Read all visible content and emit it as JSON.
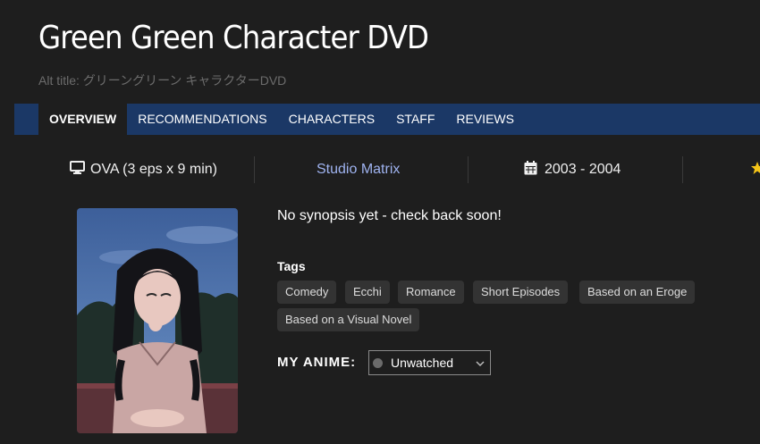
{
  "anime": {
    "title": "Green Green Character DVD",
    "alt_title": "Alt title: グリーングリーン キャラクターDVD"
  },
  "nav": {
    "tabs": [
      {
        "label": "OVERVIEW",
        "active": true
      },
      {
        "label": "RECOMMENDATIONS",
        "active": false
      },
      {
        "label": "CHARACTERS",
        "active": false
      },
      {
        "label": "STAFF",
        "active": false
      },
      {
        "label": "REVIEWS",
        "active": false
      }
    ]
  },
  "meta": {
    "format": "OVA (3 eps x 9 min)",
    "format_icon": "monitor-icon",
    "studio": "Studio Matrix",
    "years": "2003 - 2004",
    "years_icon": "calendar-icon",
    "rating_icon": "star-icon"
  },
  "main": {
    "synopsis": "No synopsis yet - check back soon!",
    "tags_label": "Tags",
    "tags": [
      "Comedy",
      "Ecchi",
      "Romance",
      "Short Episodes",
      "Based on an Eroge",
      "Based on a Visual Novel"
    ]
  },
  "my_anime": {
    "label": "MY ANIME:",
    "status": "Unwatched",
    "status_color": "#6b6b6b"
  },
  "colors": {
    "background": "#1e1e1e",
    "nav": "#1b3866",
    "studio_link": "#9fb3f0",
    "tag_bg": "#333333",
    "star": "#f5c518"
  }
}
